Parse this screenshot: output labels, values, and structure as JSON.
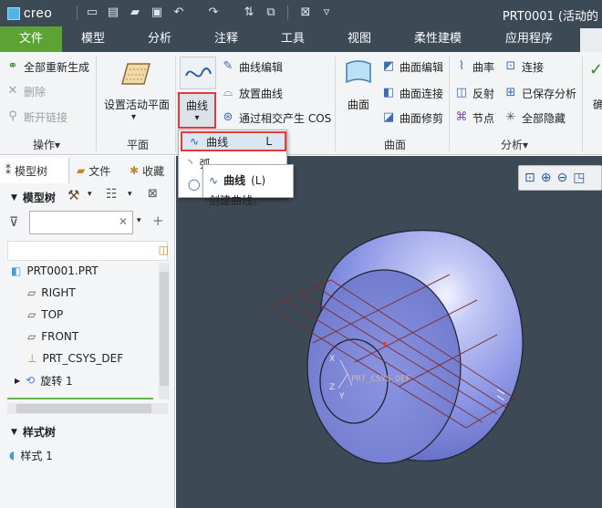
{
  "app": {
    "name": "creo",
    "window_title": "PRT0001 (活动的"
  },
  "quick_access": [
    {
      "icon": "new-file-icon"
    },
    {
      "icon": "open-file-icon"
    },
    {
      "icon": "open-folder-icon"
    },
    {
      "icon": "save-icon"
    },
    {
      "icon": "undo-icon"
    },
    {
      "icon": "redo-icon"
    },
    {
      "icon": "regenerate-icon"
    },
    {
      "icon": "windows-icon"
    },
    {
      "icon": "close-window-icon"
    },
    {
      "icon": "customize-qat-icon"
    }
  ],
  "tabs": [
    {
      "label": "文件",
      "active": true
    },
    {
      "label": "模型",
      "active": false
    },
    {
      "label": "分析",
      "active": false
    },
    {
      "label": "注释",
      "active": false
    },
    {
      "label": "工具",
      "active": false
    },
    {
      "label": "视图",
      "active": false
    },
    {
      "label": "柔性建模",
      "active": false
    },
    {
      "label": "应用程序",
      "active": false
    }
  ],
  "ribbon": {
    "operations": {
      "label": "操作",
      "regen_all": "全部重新生成",
      "delete": "删除",
      "break_link": "断开链接"
    },
    "plane": {
      "label": "平面",
      "set_active_plane": "设置活动平面"
    },
    "curve": {
      "curve_big": "曲线",
      "curve_edit": "曲线编辑",
      "place_curve": "放置曲线",
      "cos_intersect": "通过相交产生 COS"
    },
    "surface": {
      "label": "曲面",
      "surface_big": "曲面",
      "surface_edit": "曲面编辑",
      "surface_connect": "曲面连接",
      "surface_trim": "曲面修剪"
    },
    "analysis": {
      "label": "分析",
      "curvature": "曲率",
      "reflection": "反射",
      "nodes": "节点",
      "connect": "连接",
      "saved_analysis": "已保存分析",
      "hide_all": "全部隐藏"
    },
    "cut_label": "确"
  },
  "dropdown": {
    "items": [
      {
        "label": "曲线",
        "shortcut": "L"
      },
      {
        "label": "弧",
        "shortcut": ""
      },
      {
        "label": "",
        "shortcut": ""
      }
    ]
  },
  "tooltip": {
    "title": "曲线",
    "shortcut": "(L)",
    "description": "创建曲线。"
  },
  "left_panel": {
    "tabs": [
      "模型树",
      "文件",
      "收藏"
    ],
    "model_tree_label": "模型树",
    "search_placeholder": "",
    "tree": [
      {
        "label": "PRT0001.PRT",
        "icon": "part-icon"
      },
      {
        "label": "RIGHT",
        "icon": "datum-plane-icon"
      },
      {
        "label": "TOP",
        "icon": "datum-plane-icon"
      },
      {
        "label": "FRONT",
        "icon": "datum-plane-icon"
      },
      {
        "label": "PRT_CSYS_DEF",
        "icon": "csys-icon"
      },
      {
        "label": "旋转 1",
        "icon": "revolve-icon"
      }
    ],
    "style_tree_label": "样式树",
    "style_tree": [
      {
        "label": "样式 1",
        "icon": "style-icon"
      }
    ]
  },
  "viewport": {
    "csys_label": "PRT_CSYS_DEF",
    "axis_labels": [
      "X",
      "Z",
      "Y"
    ]
  },
  "colors": {
    "title_bar": "#3c4a56",
    "active_tab": "#5ba333",
    "viewport_bg": "#3d4a56",
    "highlight": "#e23a3a",
    "model_fill": "#8c96e6"
  }
}
